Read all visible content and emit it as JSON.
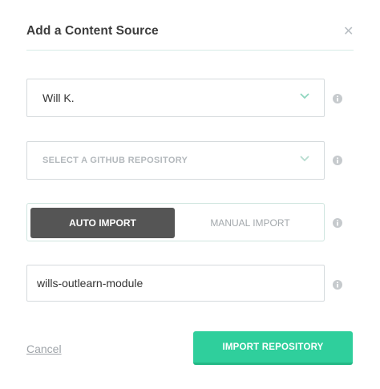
{
  "dialog": {
    "title": "Add a Content Source",
    "close_icon": "close-icon"
  },
  "account_select": {
    "selected": "Will K.",
    "icon": "chevron-down-icon"
  },
  "repo_select": {
    "placeholder": "SELECT A GITHUB REPOSITORY",
    "icon": "chevron-down-icon"
  },
  "import_mode": {
    "options": [
      {
        "label": "AUTO IMPORT",
        "selected": true
      },
      {
        "label": "MANUAL IMPORT",
        "selected": false
      }
    ]
  },
  "name_input": {
    "value": "wills-outlearn-module"
  },
  "footer": {
    "cancel_label": "Cancel",
    "import_label": "IMPORT REPOSITORY"
  },
  "colors": {
    "accent": "#2fcf9c",
    "selected_toggle": "#555555",
    "divider": "#d7ebe6"
  }
}
